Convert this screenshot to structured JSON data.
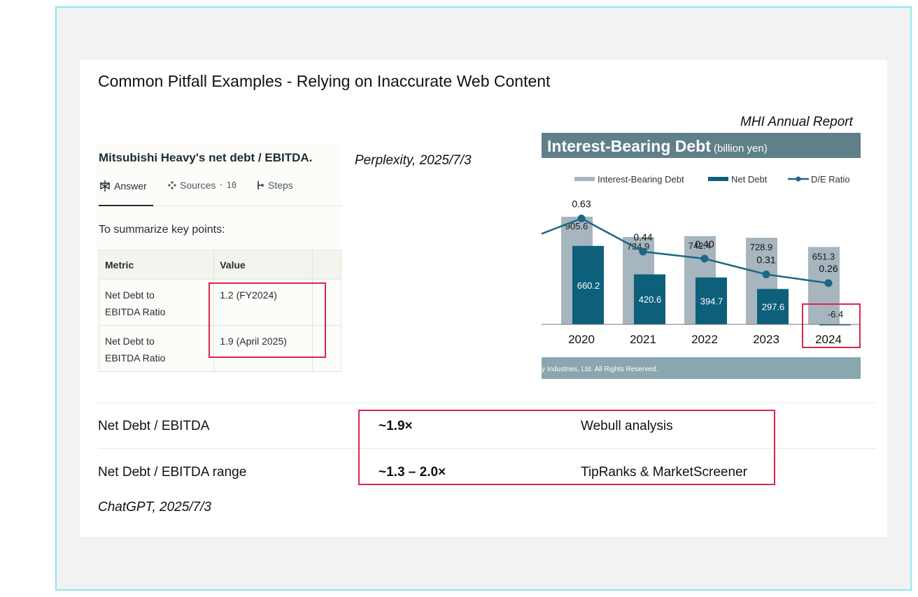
{
  "slide": {
    "title": "Common Pitfall Examples - Relying on Inaccurate Web Content"
  },
  "perplexity": {
    "caption": "Perplexity, 2025/7/3",
    "question": "Mitsubishi Heavy's net debt / EBITDA.",
    "tabs": [
      {
        "label": "Answer",
        "icon": "perplexity-logo-icon"
      },
      {
        "label": "Sources",
        "count": "10",
        "icon": "sources-icon"
      },
      {
        "label": "Steps",
        "icon": "steps-icon"
      }
    ],
    "summary": "To summarize key points:",
    "table": {
      "headers": [
        "Metric",
        "Value"
      ],
      "rows": [
        {
          "metric": "Net Debt to EBITDA Ratio",
          "value": "1.2 (FY2024)"
        },
        {
          "metric": "Net Debt to EBITDA Ratio",
          "value": "1.9 (April 2025)"
        }
      ]
    }
  },
  "mhi": {
    "caption": "MHI Annual Report",
    "footer": "y Industries, Ltd.  All Rights Reserved.",
    "colors": {
      "header": "#5f7f89",
      "gross": "#a6b5be",
      "net": "#0d5f7a",
      "ratio": "#1a6884",
      "footer": "#8aa6ae"
    }
  },
  "chart_data": {
    "type": "bar",
    "title": "Interest-Bearing Debt",
    "subtitle": "(billion yen)",
    "categories": [
      "2020",
      "2021",
      "2022",
      "2023",
      "2024"
    ],
    "series": [
      {
        "name": "Interest-Bearing Debt",
        "values": [
          905.6,
          734.9,
          742.4,
          728.9,
          651.3
        ]
      },
      {
        "name": "Net Debt",
        "values": [
          660.2,
          420.6,
          394.7,
          297.6,
          -6.4
        ]
      },
      {
        "name": "D/E Ratio",
        "type": "line",
        "values": [
          0.63,
          0.44,
          0.4,
          0.31,
          0.26
        ]
      }
    ],
    "legend": "top-right",
    "grid": false
  },
  "chatgpt": {
    "caption": "ChatGPT, 2025/7/3",
    "rows": [
      {
        "label": "Net Debt / EBITDA",
        "value": "~1.9×",
        "source": "Webull analysis"
      },
      {
        "label": "Net Debt / EBITDA range",
        "value": "~1.3 – 2.0×",
        "source": "TipRanks & MarketScreener"
      }
    ]
  }
}
